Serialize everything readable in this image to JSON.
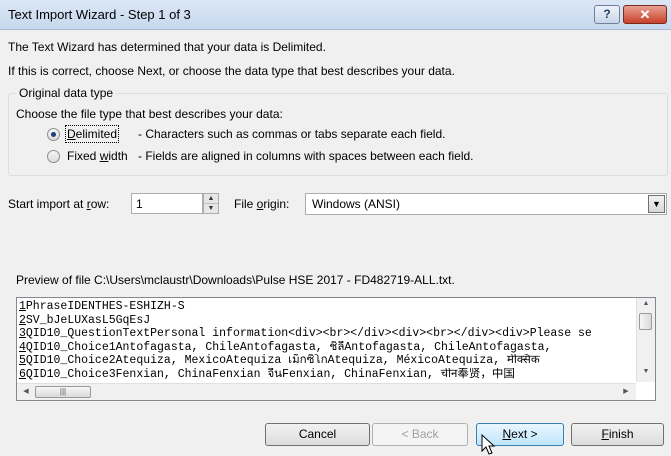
{
  "window": {
    "title": "Text Import Wizard - Step 1 of 3",
    "help_glyph": "?",
    "close_glyph": "✕"
  },
  "intro": {
    "line1": "The Text Wizard has determined that your data is Delimited.",
    "line2": "If this is correct, choose Next, or choose the data type that best describes your data."
  },
  "group": {
    "legend": "Original data type",
    "prompt": "Choose the file type that best describes your data:",
    "options": [
      {
        "key": "D",
        "rest": "elimited",
        "desc": "- Characters such as commas or tabs separate each field.",
        "checked": true
      },
      {
        "pre": "Fixed ",
        "key": "w",
        "rest": "idth",
        "desc": "- Fields are aligned in columns with spaces between each field.",
        "checked": false
      }
    ]
  },
  "start_row": {
    "label_pre": "Start import at ",
    "label_key": "r",
    "label_post": "ow:",
    "value": "1"
  },
  "file_origin": {
    "label_pre": "File ",
    "label_key": "o",
    "label_post": "rigin:",
    "value": "Windows (ANSI)"
  },
  "preview": {
    "label": "Preview of file C:\\Users\\mclaustr\\Downloads\\Pulse HSE 2017 - FD482719-ALL.txt.",
    "lines": [
      {
        "num": "1",
        "text": "PhraseIDENTHES-ESHIZH-S"
      },
      {
        "num": "2",
        "text": "SV_bJeLUXasL5GqEsJ"
      },
      {
        "num": "3",
        "text": "QID10_QuestionTextPersonal information<div><br></div><div><br></div><div>Please se"
      },
      {
        "num": "4",
        "text": "QID10_Choice1Antofagasta, ChileAntofagasta, ชิลีAntofagasta, ChileAntofagasta,"
      },
      {
        "num": "5",
        "text": "QID10_Choice2Atequiza, MexicoAtequiza เม็กซิโกAtequiza, MéxicoAtequiza, मेक्सिक"
      },
      {
        "num": "6",
        "text": "QID10_Choice3Fenxian, ChinaFenxian จีนFenxian, ChinaFenxian, चीन奉贤，中国"
      }
    ],
    "hthumb_glyph": "|||"
  },
  "buttons": {
    "cancel": "Cancel",
    "back": "< Back",
    "next_key": "N",
    "next_rest": "ext >",
    "finish_key": "F",
    "finish_rest": "inish"
  }
}
